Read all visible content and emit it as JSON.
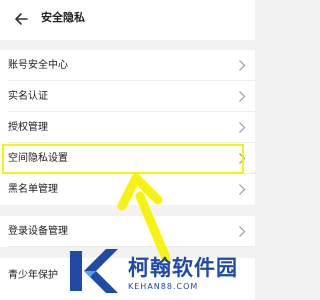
{
  "header": {
    "back_icon": "back-arrow-icon",
    "title": "安全隐私"
  },
  "groups": [
    {
      "items": [
        {
          "label": "账号安全中心",
          "icon": "chevron-right-icon"
        },
        {
          "label": "实名认证",
          "icon": "chevron-right-icon"
        },
        {
          "label": "授权管理",
          "icon": "chevron-right-icon"
        },
        {
          "label": "空间隐私设置",
          "icon": "chevron-right-icon",
          "highlighted": true
        },
        {
          "label": "黑名单管理",
          "icon": "chevron-right-icon"
        }
      ]
    },
    {
      "items": [
        {
          "label": "登录设备管理",
          "icon": "chevron-right-icon"
        },
        {
          "label": "青少年保护",
          "icon": "chevron-right-icon"
        }
      ]
    }
  ],
  "annotation": {
    "highlight_color": "#f7f20f",
    "arrow_color": "#f7f20f"
  },
  "watermark": {
    "brand": "柯翰软件园",
    "url": "KEHAN88.COM",
    "color": "#1f4aa8"
  }
}
